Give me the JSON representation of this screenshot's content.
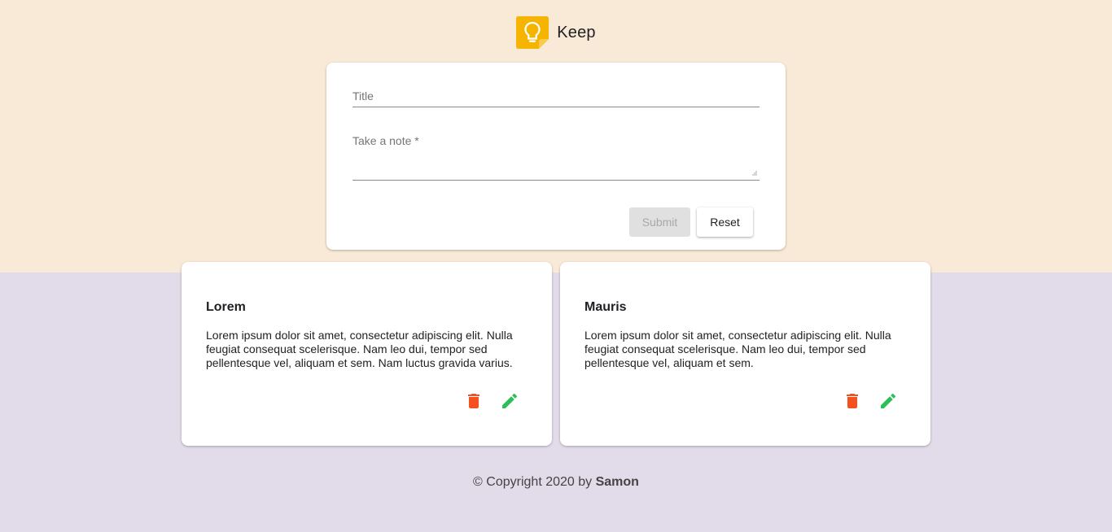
{
  "header": {
    "app_title": "Keep",
    "logo_icon": "lightbulb-icon",
    "logo_color": "#F4B400"
  },
  "form": {
    "title_placeholder": "Title",
    "note_placeholder": "Take a note *",
    "submit_label": "Submit",
    "reset_label": "Reset"
  },
  "notes": [
    {
      "title": "Lorem",
      "body": "Lorem ipsum dolor sit amet, consectetur adipiscing elit. Nulla feugiat consequat scelerisque. Nam leo dui, tempor sed pellentesque vel, aliquam et sem. Nam luctus gravida varius.",
      "delete_icon": "trash-icon",
      "edit_icon": "pencil-icon"
    },
    {
      "title": "Mauris",
      "body": "Lorem ipsum dolor sit amet, consectetur adipiscing elit. Nulla feugiat consequat scelerisque. Nam leo dui, tempor sed pellentesque vel, aliquam et sem.",
      "delete_icon": "trash-icon",
      "edit_icon": "pencil-icon"
    }
  ],
  "footer": {
    "copyright_prefix": "© Copyright 2020 by ",
    "author": "Samon"
  },
  "colors": {
    "top_background": "#F9EAD7",
    "bottom_background": "#E2DBEA",
    "delete_color": "#F4511E",
    "edit_color": "#2EBD59"
  }
}
